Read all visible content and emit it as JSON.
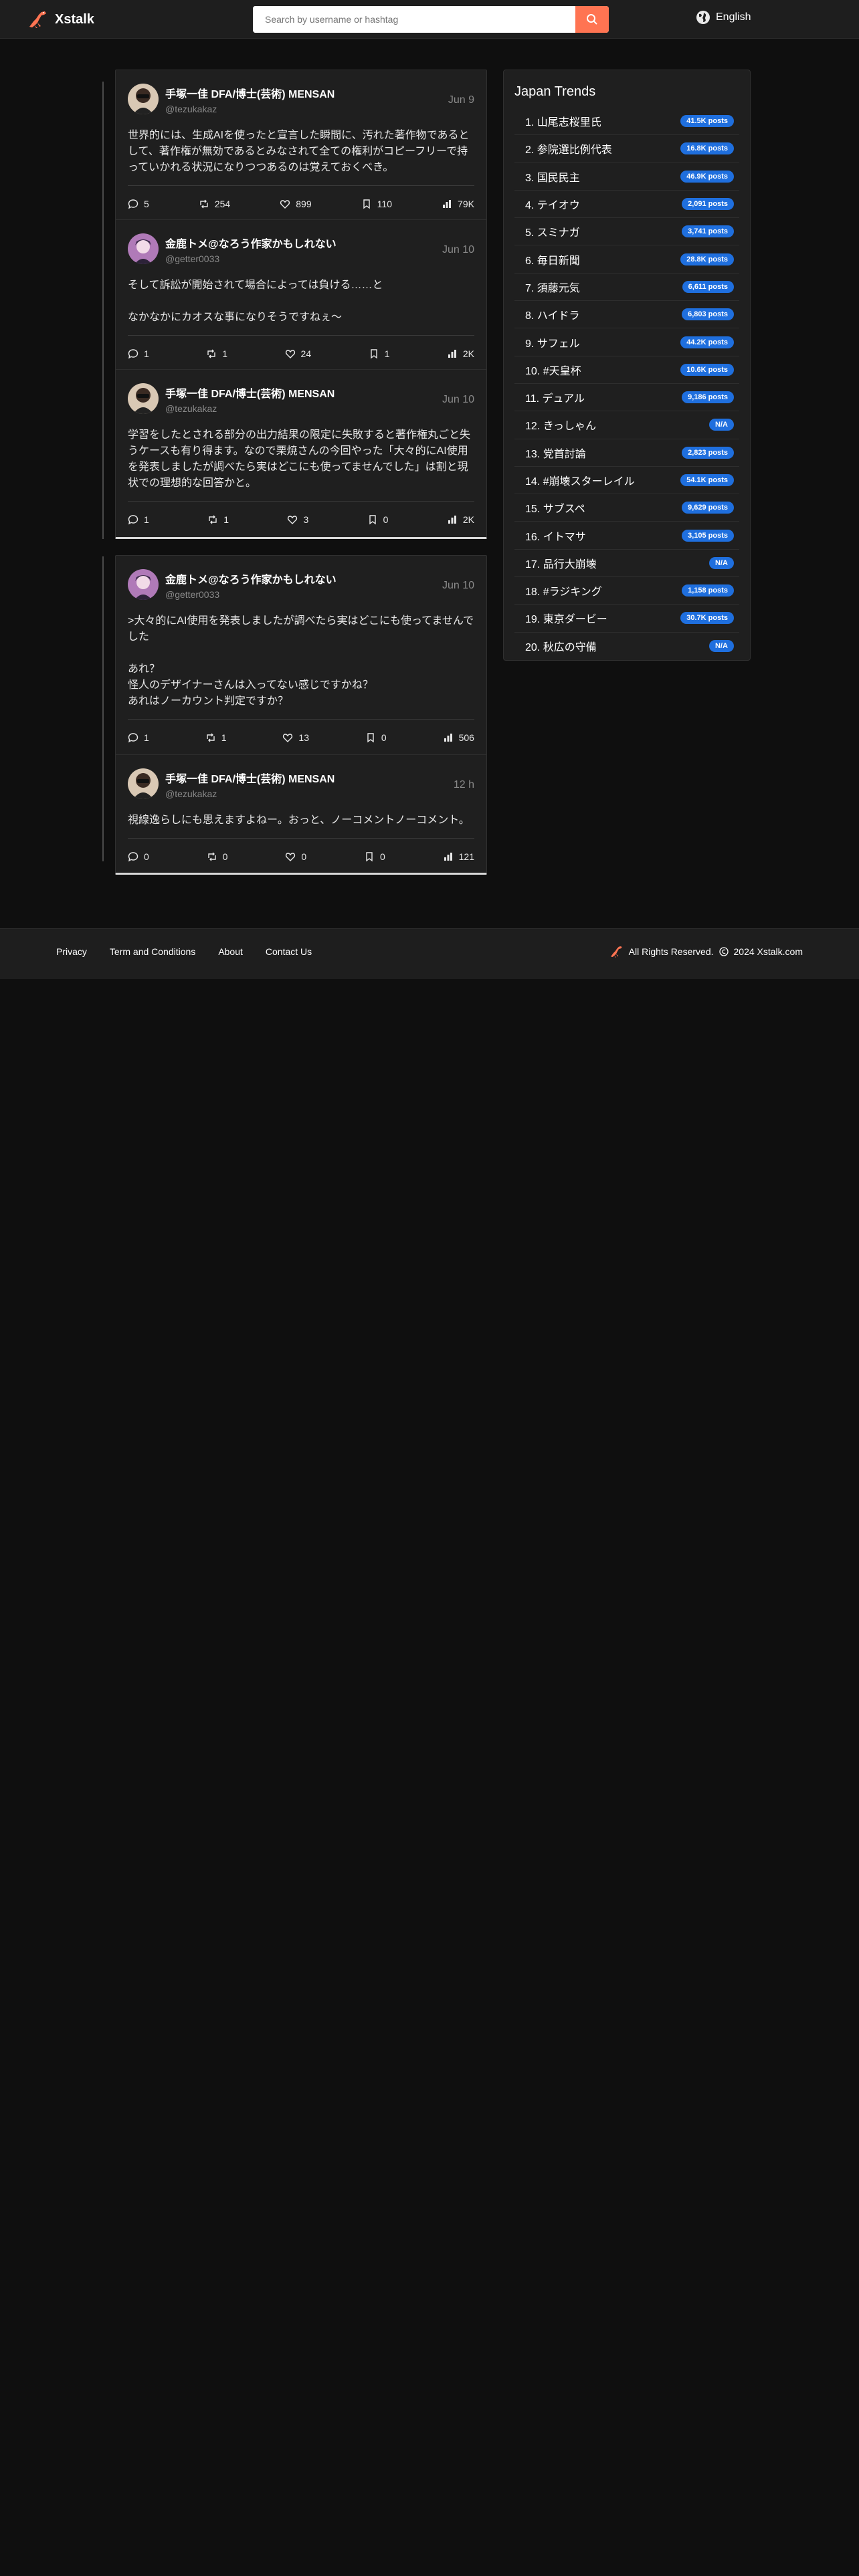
{
  "header": {
    "brand": "Xstalk",
    "search_placeholder": "Search by username or hashtag",
    "language": "English"
  },
  "threads": [
    {
      "posts": [
        {
          "display_name": "手塚一佳 DFA/博士(芸術) MENSAN",
          "handle": "@tezukakaz",
          "date": "Jun 9",
          "body": "世界的には、生成AIを使ったと宣言した瞬間に、汚れた著作物であるとして、著作権が無効であるとみなされて全ての権利がコピーフリーで持っていかれる状況になりつつあるのは覚えておくべき。",
          "stats": {
            "replies": "5",
            "reposts": "254",
            "likes": "899",
            "bookmarks": "110",
            "views": "79K"
          }
        },
        {
          "display_name": "金鹿トメ@なろう作家かもしれない",
          "handle": "@getter0033",
          "date": "Jun 10",
          "body": "そして訴訟が開始されて場合によっては負ける……と\n\nなかなかにカオスな事になりそうですねぇ～",
          "stats": {
            "replies": "1",
            "reposts": "1",
            "likes": "24",
            "bookmarks": "1",
            "views": "2K"
          }
        },
        {
          "display_name": "手塚一佳 DFA/博士(芸術) MENSAN",
          "handle": "@tezukakaz",
          "date": "Jun 10",
          "body": "学習をしたとされる部分の出力結果の限定に失敗すると著作権丸ごと失うケースも有り得ます。なので栗焼さんの今回やった「大々的にAI使用を発表しましたが調べたら実はどこにも使ってませんでした」は割と現状での理想的な回答かと。",
          "stats": {
            "replies": "1",
            "reposts": "1",
            "likes": "3",
            "bookmarks": "0",
            "views": "2K"
          }
        }
      ]
    },
    {
      "posts": [
        {
          "display_name": "金鹿トメ@なろう作家かもしれない",
          "handle": "@getter0033",
          "date": "Jun 10",
          "body": ">大々的にAI使用を発表しましたが調べたら実はどこにも使ってませんでした\n\nあれ？\n怪人のデザイナーさんは入ってない感じですかね？\nあれはノーカウント判定ですか？",
          "stats": {
            "replies": "1",
            "reposts": "1",
            "likes": "13",
            "bookmarks": "0",
            "views": "506"
          }
        },
        {
          "display_name": "手塚一佳 DFA/博士(芸術) MENSAN",
          "handle": "@tezukakaz",
          "date": "12 h",
          "body": "視線逸らしにも思えますよねー。おっと、ノーコメントノーコメント。",
          "stats": {
            "replies": "0",
            "reposts": "0",
            "likes": "0",
            "bookmarks": "0",
            "views": "121"
          }
        }
      ]
    }
  ],
  "trends": {
    "title": "Japan Trends",
    "items": [
      {
        "label": "1. 山尾志桜里氏",
        "count": "41.5K posts"
      },
      {
        "label": "2. 参院選比例代表",
        "count": "16.8K posts"
      },
      {
        "label": "3. 国民民主",
        "count": "46.9K posts"
      },
      {
        "label": "4. テイオウ",
        "count": "2,091 posts"
      },
      {
        "label": "5. スミナガ",
        "count": "3,741 posts"
      },
      {
        "label": "6. 毎日新聞",
        "count": "28.8K posts"
      },
      {
        "label": "7. 須藤元気",
        "count": "6,611 posts"
      },
      {
        "label": "8. ハイドラ",
        "count": "6,803 posts"
      },
      {
        "label": "9. サフェル",
        "count": "44.2K posts"
      },
      {
        "label": "10. #天皇杯",
        "count": "10.6K posts"
      },
      {
        "label": "11. デュアル",
        "count": "9,186 posts"
      },
      {
        "label": "12. きっしゃん",
        "count": "N/A"
      },
      {
        "label": "13. 党首討論",
        "count": "2,823 posts"
      },
      {
        "label": "14. #崩壊スターレイル",
        "count": "54.1K posts"
      },
      {
        "label": "15. サブスペ",
        "count": "9,629 posts"
      },
      {
        "label": "16. イトマサ",
        "count": "3,105 posts"
      },
      {
        "label": "17. 品行大崩壊",
        "count": "N/A"
      },
      {
        "label": "18. #ラジキング",
        "count": "1,158 posts"
      },
      {
        "label": "19. 東京ダービー",
        "count": "30.7K posts"
      },
      {
        "label": "20. 秋広の守備",
        "count": "N/A"
      }
    ]
  },
  "footer": {
    "links": [
      "Privacy",
      "Term and Conditions",
      "About",
      "Contact Us"
    ],
    "rights": "All Rights Reserved.",
    "copyright": "2024 Xstalk.com"
  },
  "colors": {
    "accent": "#ff7452",
    "pill": "#1f6fde",
    "bg": "#0f0f0f",
    "card": "#1f1f1f"
  }
}
